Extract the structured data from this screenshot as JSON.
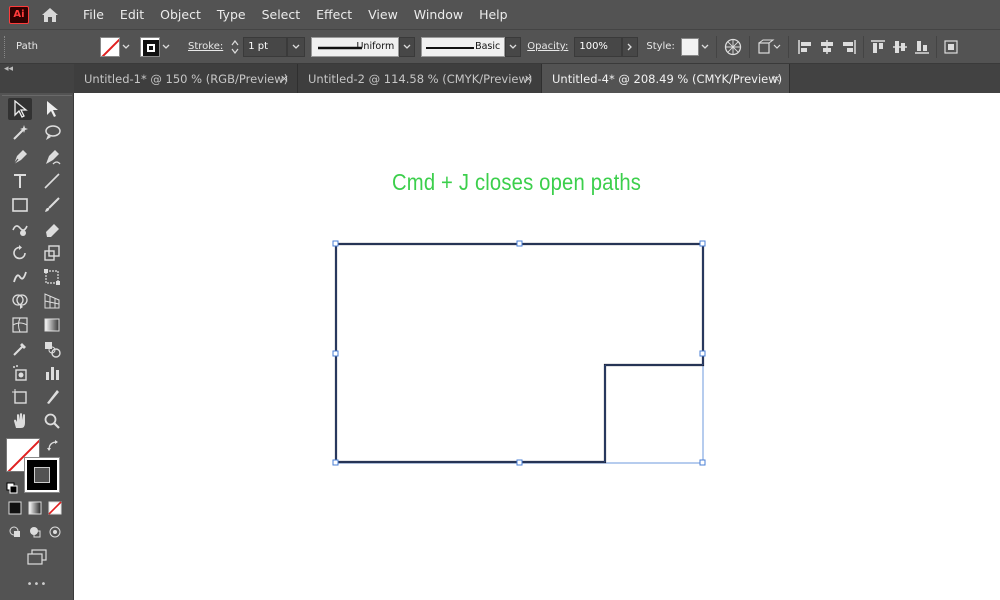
{
  "app": {
    "logo_text": "Ai"
  },
  "menu": [
    "File",
    "Edit",
    "Object",
    "Type",
    "Select",
    "Effect",
    "View",
    "Window",
    "Help"
  ],
  "control_bar": {
    "selection_label": "Path",
    "stroke_label": "Stroke:",
    "stroke_weight": "1 pt",
    "stroke_profile": "Uniform",
    "brush": "Basic",
    "opacity_label": "Opacity:",
    "opacity_value": "100%",
    "style_label": "Style:"
  },
  "tabs": [
    {
      "label": "Untitled-1* @ 150 % (RGB/Preview)",
      "close": "×",
      "active": false
    },
    {
      "label": "Untitled-2 @ 114.58 % (CMYK/Preview)",
      "close": "×",
      "active": false
    },
    {
      "label": "Untitled-4* @ 208.49 % (CMYK/Preview)",
      "close": "×",
      "active": true
    }
  ],
  "tabstrip": {
    "collapse_glyph": "◂◂"
  },
  "toolbar": {
    "more_glyph": "•••"
  },
  "canvas": {
    "annotation": "Cmd + J closes open paths"
  },
  "colors": {
    "annotation": "#3ccf4c",
    "selection": "#4a7fd6",
    "path_stroke": "#1b1b2a",
    "ui_bg": "#535353"
  }
}
